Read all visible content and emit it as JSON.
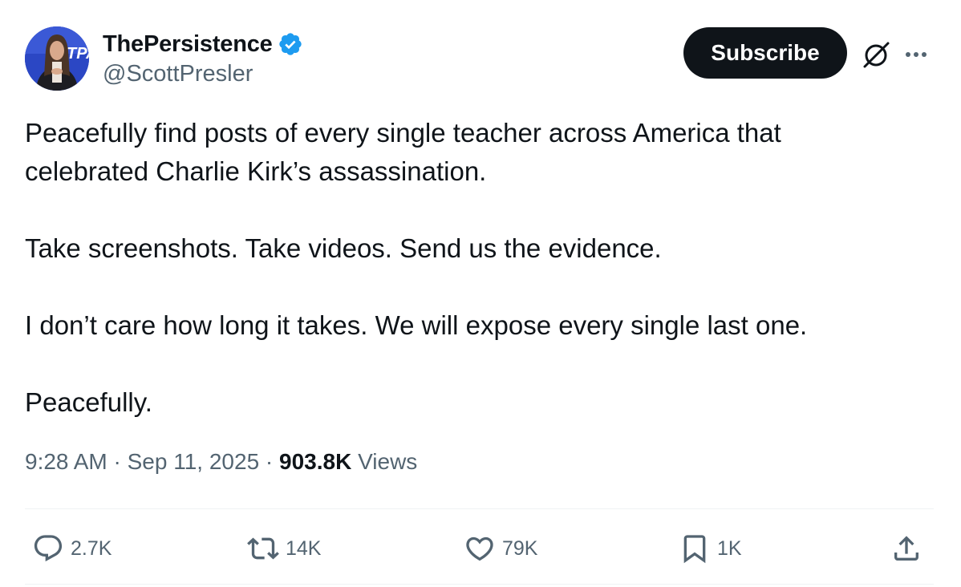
{
  "author": {
    "display_name": "ThePersistence",
    "handle": "@ScottPresler",
    "verified": true,
    "verified_color": "#1d9bf0",
    "avatar_badge_text": "TPA"
  },
  "header": {
    "subscribe_label": "Subscribe",
    "grok_icon": "grok-icon",
    "more_icon": "more-options-icon"
  },
  "post": {
    "paragraphs": [
      [
        "Peacefully find posts of every single teacher across America that",
        "celebrated Charlie Kirk’s assassination."
      ],
      [
        "Take screenshots. Take videos. Send us the evidence."
      ],
      [
        "I don’t care how long it takes. We will expose every single last one."
      ],
      [
        "Peacefully."
      ]
    ]
  },
  "meta": {
    "time": "9:28 AM",
    "separator": " · ",
    "date": "Sep 11, 2025",
    "views_count": "903.8K",
    "views_label": " Views"
  },
  "actions": {
    "reply": {
      "icon": "reply-icon",
      "count": "2.7K"
    },
    "retweet": {
      "icon": "retweet-icon",
      "count": "14K"
    },
    "like": {
      "icon": "heart-icon",
      "count": "79K"
    },
    "bookmark": {
      "icon": "bookmark-icon",
      "count": "1K"
    },
    "share": {
      "icon": "share-icon"
    }
  },
  "colors": {
    "text": "#0f1419",
    "secondary": "#536471",
    "button_bg": "#0f1419",
    "divider": "#eff3f4"
  }
}
